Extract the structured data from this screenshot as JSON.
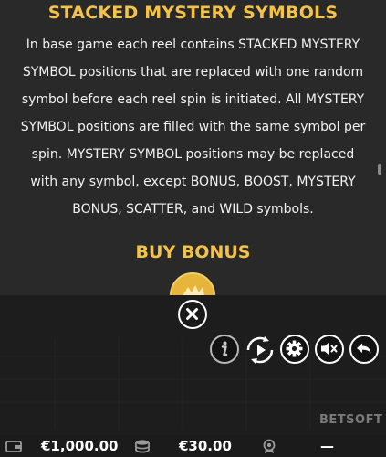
{
  "info": {
    "title": "STACKED MYSTERY SYMBOLS",
    "paragraph_lines": [
      "In base game each reel contains STACKED MYSTERY",
      "SYMBOL positions that are replaced with one random",
      "symbol before each reel spin is initiated. All MYSTERY",
      "SYMBOL positions are filled with the same symbol per",
      "spin. MYSTERY SYMBOL positions may be replaced",
      "with any symbol, except BONUS, BOOST, MYSTERY",
      "BONUS, SCATTER, and WILD symbols."
    ],
    "buy_bonus_title": "BUY BONUS"
  },
  "controls": {
    "close_icon": "close-icon",
    "info_icon": "info-icon",
    "autoplay_icon": "autoplay-icon",
    "settings_icon": "gear-icon",
    "sound_icon": "mute-speaker-icon",
    "back_icon": "back-arrow-icon"
  },
  "branding": {
    "logo_text": "BETSOFT"
  },
  "status": {
    "balance": "€1,000.00",
    "bet": "€30.00",
    "win": "—"
  },
  "colors": {
    "accent_gold": "#f4c247",
    "text": "#f2f2f2",
    "panel_bg": "#292929"
  }
}
